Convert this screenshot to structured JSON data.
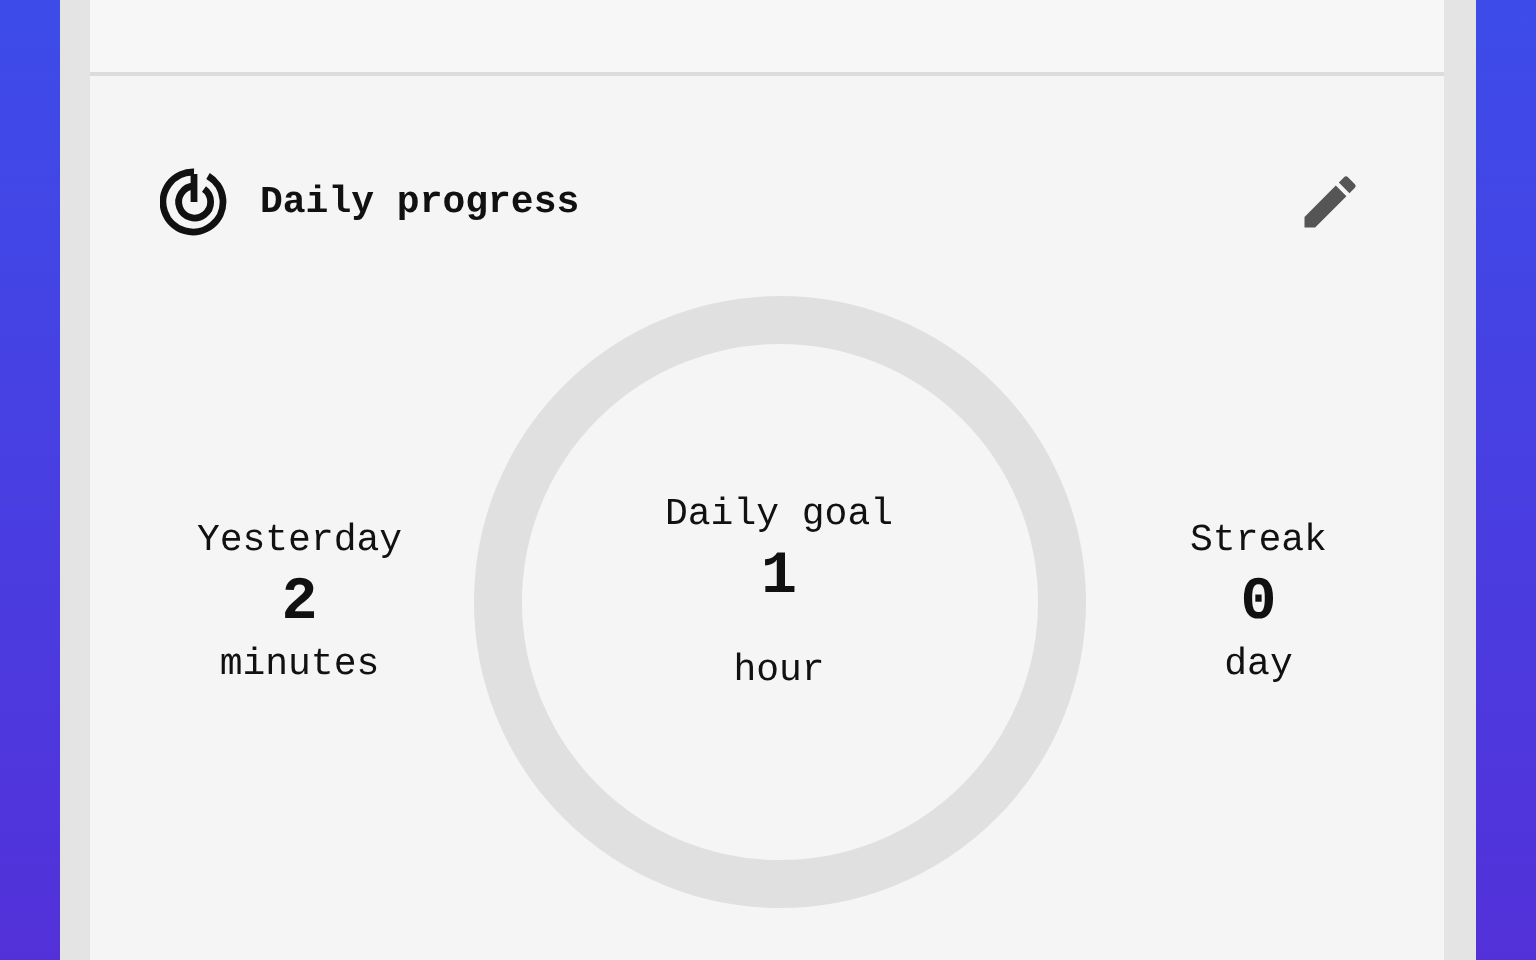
{
  "card": {
    "title": "Daily progress"
  },
  "stats": [
    {
      "label": "Yesterday",
      "value": "2",
      "unit": "minutes"
    },
    {
      "label": "Daily goal",
      "value": "1",
      "unit": "hour"
    },
    {
      "label": "Streak",
      "value": "0",
      "unit": "day"
    }
  ]
}
